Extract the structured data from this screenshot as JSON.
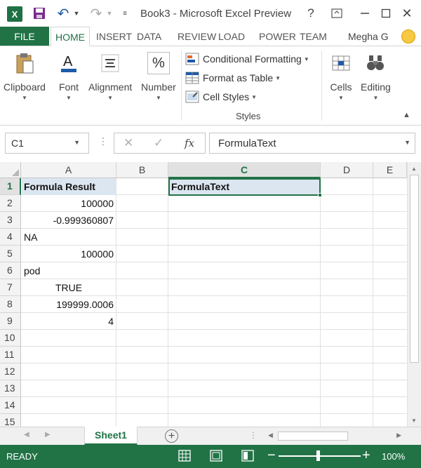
{
  "titlebar": {
    "title": "Book3 - Microsoft Excel Preview",
    "logo_letter": "X",
    "undo_icon": "undo-icon",
    "redo_icon": "redo-icon",
    "help_label": "?",
    "close_label": "✕"
  },
  "tabs": [
    {
      "label": "FILE"
    },
    {
      "label": "HOME"
    },
    {
      "label": "INSERT"
    },
    {
      "label": "DATA"
    },
    {
      "label": "REVIEW"
    },
    {
      "label": "LOAD"
    },
    {
      "label": "POWER"
    },
    {
      "label": "TEAM"
    }
  ],
  "account": {
    "name": "Megha G"
  },
  "ribbon": {
    "clipboard": "Clipboard",
    "font": "Font",
    "alignment": "Alignment",
    "number": "Number",
    "conditional_formatting": "Conditional Formatting",
    "format_as_table": "Format as Table",
    "cell_styles": "Cell Styles",
    "styles_group": "Styles",
    "cells": "Cells",
    "editing": "Editing",
    "number_symbol": "%"
  },
  "formula_bar": {
    "name_box": "C1",
    "fx_label": "fx",
    "cancel_label": "✕",
    "enter_label": "✓",
    "formula": "FormulaText"
  },
  "grid": {
    "columns": [
      "A",
      "B",
      "C",
      "D",
      "E"
    ],
    "selected_column": "C",
    "selected_row": "1",
    "rows": [
      "1",
      "2",
      "3",
      "4",
      "5",
      "6",
      "7",
      "8",
      "9",
      "10",
      "11",
      "12",
      "13",
      "14",
      "15"
    ],
    "cells": {
      "A1": "Formula Result",
      "C1": "FormulaText",
      "A2": "100000",
      "A3": "-0.999360807",
      "A4": "NA",
      "A5": "100000",
      "A6": "pod",
      "A7": "TRUE",
      "A8": "199999.0006",
      "A9": "4"
    }
  },
  "sheets": {
    "active": "Sheet1",
    "add_label": "+"
  },
  "status": {
    "text": "READY",
    "zoom": "100%",
    "zoom_fraction": 0.5
  },
  "colors": {
    "accent": "#217346",
    "selection": "#dce6f1"
  }
}
